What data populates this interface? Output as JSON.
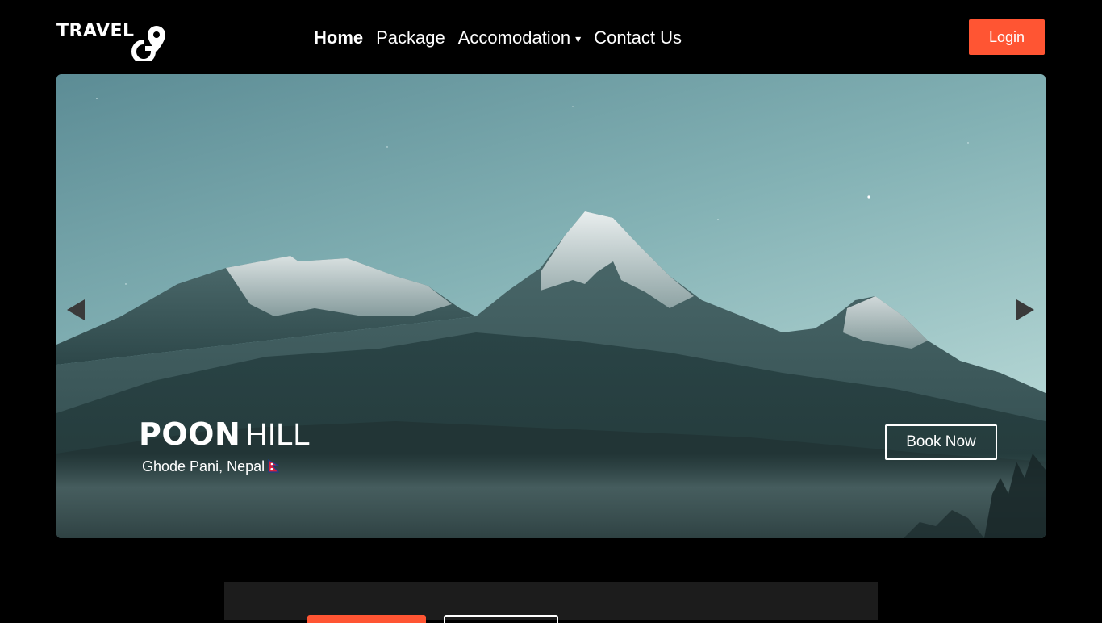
{
  "brand": {
    "logo_text": "TRAVEL",
    "logo_mark_letter": "GO",
    "accent_color": "#ff5533"
  },
  "nav": {
    "items": [
      {
        "label": "Home",
        "active": true
      },
      {
        "label": "Package",
        "active": false
      },
      {
        "label": "Accomodation",
        "active": false,
        "has_dropdown": true
      },
      {
        "label": "Contact Us",
        "active": false
      }
    ],
    "dropdown_caret": "▾",
    "login_label": "Login"
  },
  "hero": {
    "title_bold": "POON",
    "title_light": "HILL",
    "location": "Ghode Pani, Nepal",
    "flag_icon": "nepal-flag-icon",
    "book_label": "Book Now",
    "prev_icon": "triangle-left-icon",
    "next_icon": "triangle-right-icon"
  },
  "panel": {
    "primary_button_color": "#ff5533"
  }
}
